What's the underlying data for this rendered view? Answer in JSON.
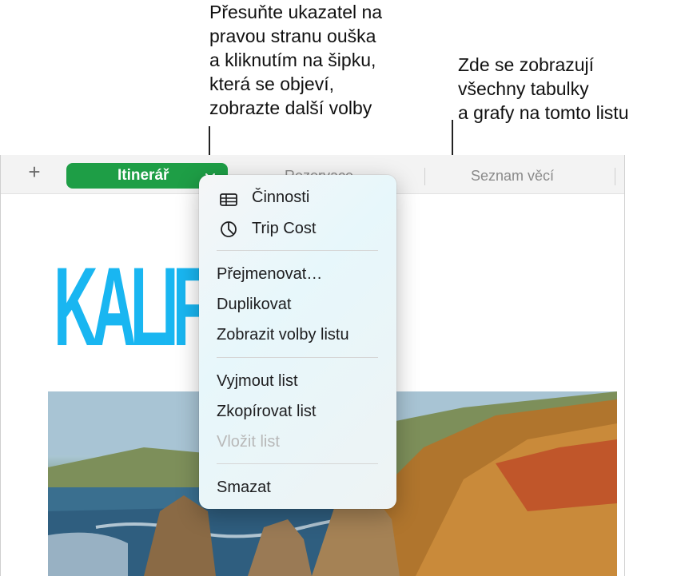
{
  "callouts": {
    "left": "Přesuňte ukazatel na\npravou stranu ouška\na kliknutím na šipku,\nkterá se objeví,\nzobrazte další volby",
    "right": "Zde se zobrazují\nvšechny tabulky\na grafy na tomto listu"
  },
  "tabbar": {
    "add_label": "+",
    "active_tab": "Itinerář",
    "active_chevron": "⌄",
    "tab_bookings": "Rezervace",
    "tab_packing": "Seznam věcí"
  },
  "document": {
    "title": "KALIFORNIE"
  },
  "menu": {
    "objects": [
      {
        "label": "Činnosti",
        "icon": "table-icon"
      },
      {
        "label": "Trip Cost",
        "icon": "chart-icon"
      }
    ],
    "sheet_actions": [
      "Přejmenovat…",
      "Duplikovat",
      "Zobrazit volby listu"
    ],
    "clipboard_actions": [
      "Vyjmout list",
      "Zkopírovat list",
      "Vložit list"
    ],
    "delete_action": "Smazat"
  },
  "colors": {
    "tab_active": "#1e9e46",
    "title": "#19b6f1"
  }
}
